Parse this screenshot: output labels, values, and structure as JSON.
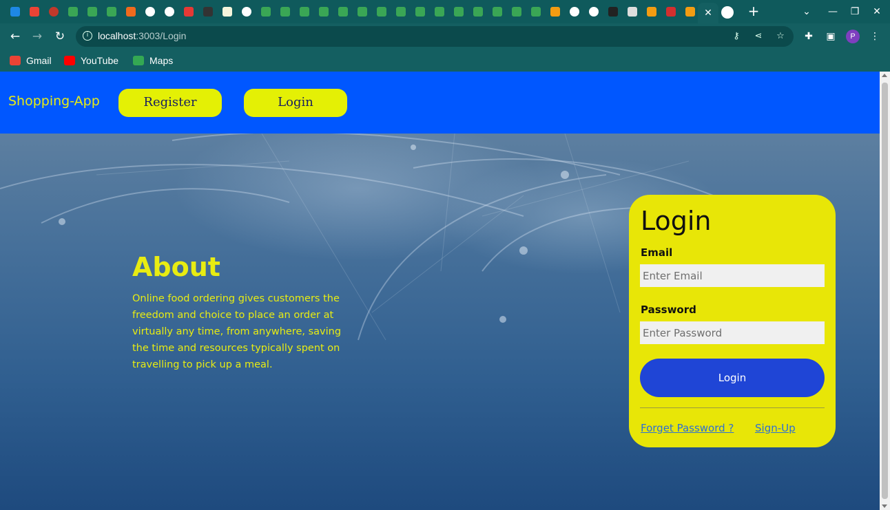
{
  "browser": {
    "url_host": "localhost",
    "url_rest": ":3003/Login",
    "bookmarks": [
      {
        "label": "Gmail",
        "icon": "gmail-icon",
        "color": "#ea4335"
      },
      {
        "label": "YouTube",
        "icon": "youtube-icon",
        "color": "#ff0000"
      },
      {
        "label": "Maps",
        "icon": "maps-icon",
        "color": "#34a853"
      }
    ],
    "profile_initial": "P"
  },
  "navbar": {
    "brand": "Shopping-App",
    "register_label": "Register",
    "login_label": "Login",
    "background": "#0057ff",
    "pill_color": "#e4f005"
  },
  "about": {
    "title": "About",
    "text": "Online food ordering gives customers the freedom and choice to place an order at virtually any time, from anywhere, saving the time and resources typically spent on travelling to pick up a meal."
  },
  "login_form": {
    "title": "Login",
    "email_label": "Email",
    "email_placeholder": "Enter Email",
    "password_label": "Password",
    "password_placeholder": "Enter Password",
    "submit_label": "Login",
    "forgot_label": "Forget Password ?",
    "signup_label": "Sign-Up",
    "card_color": "#e8e607",
    "button_color": "#1f45d6"
  }
}
